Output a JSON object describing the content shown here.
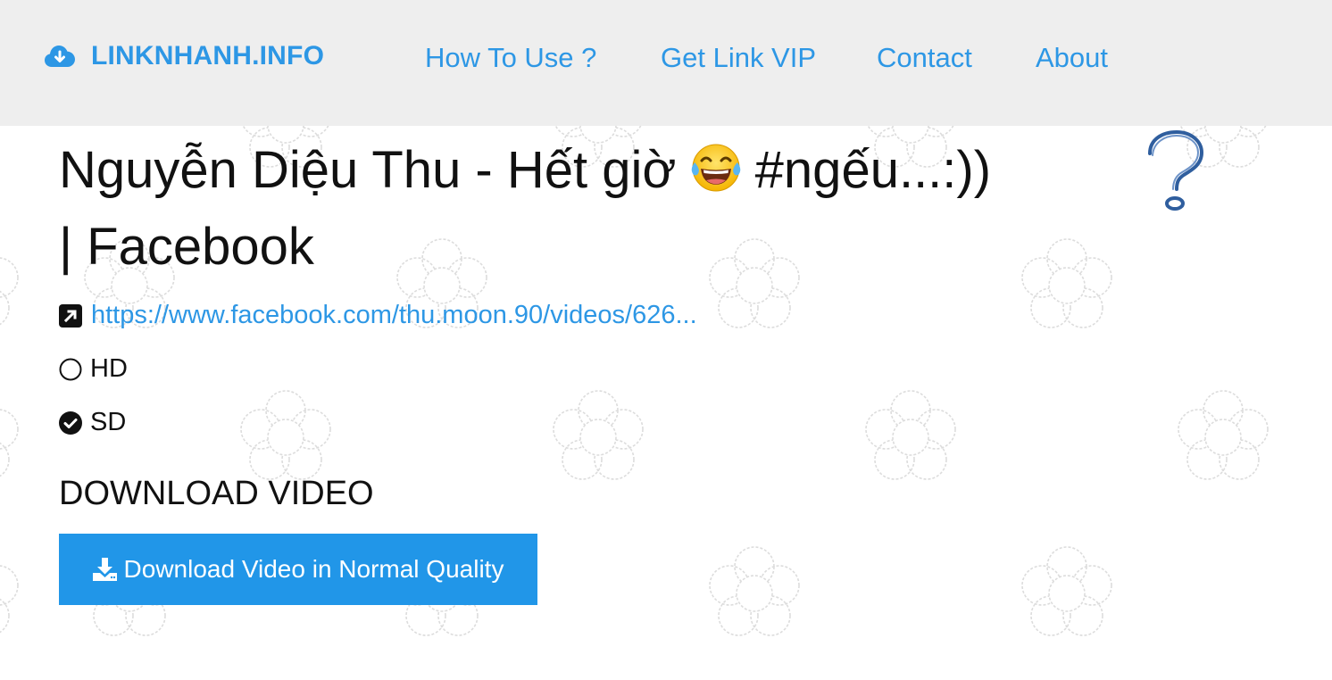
{
  "navbar": {
    "brand": "LINKNHANH.INFO",
    "brand_icon": "cloud-download-icon",
    "links": [
      {
        "label": "How To Use ?"
      },
      {
        "label": "Get Link VIP"
      },
      {
        "label": "Contact"
      },
      {
        "label": "About"
      }
    ]
  },
  "video": {
    "title_part1": "Nguyễn Diệu Thu - Hết giờ",
    "title_emoji": "face-with-tears-of-joy",
    "title_part2": "#ngếu...:))",
    "title_line2": "| Facebook",
    "url": "https://www.facebook.com/thu.moon.90/videos/626...",
    "url_icon": "external-link-icon",
    "help_icon": "question-mark-icon"
  },
  "quality_options": [
    {
      "label": "HD",
      "selected": false
    },
    {
      "label": "SD",
      "selected": true
    }
  ],
  "download": {
    "section_title": "DOWNLOAD VIDEO",
    "button_label": "Download Video in Normal Quality",
    "button_icon": "download-icon"
  },
  "colors": {
    "accent": "#2d97e5",
    "button": "#2196e8",
    "navbar_bg": "#eeeeee",
    "text": "#111111"
  }
}
